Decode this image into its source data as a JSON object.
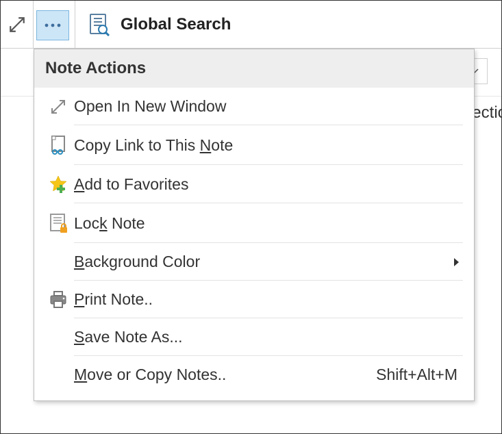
{
  "header": {
    "title": "Global Search"
  },
  "background": {
    "fragment": "ectio"
  },
  "menu": {
    "title": "Note Actions",
    "items": [
      {
        "label": "Open In New Window",
        "shortcut": "",
        "submenu": false,
        "underline": null
      },
      {
        "label": "Copy Link to This Note",
        "shortcut": "",
        "submenu": false,
        "underline": "N"
      },
      {
        "label": "Add to Favorites",
        "shortcut": "",
        "submenu": false,
        "underline": "A"
      },
      {
        "label": "Lock Note",
        "shortcut": "",
        "submenu": false,
        "underline": "k"
      },
      {
        "label": "Background Color",
        "shortcut": "",
        "submenu": true,
        "underline": "B"
      },
      {
        "label": "Print Note..",
        "shortcut": "",
        "submenu": false,
        "underline": "P"
      },
      {
        "label": "Save Note As...",
        "shortcut": "",
        "submenu": false,
        "underline": "S"
      },
      {
        "label": "Move or Copy Notes..",
        "shortcut": "Shift+Alt+M",
        "submenu": false,
        "underline": "M"
      }
    ]
  }
}
